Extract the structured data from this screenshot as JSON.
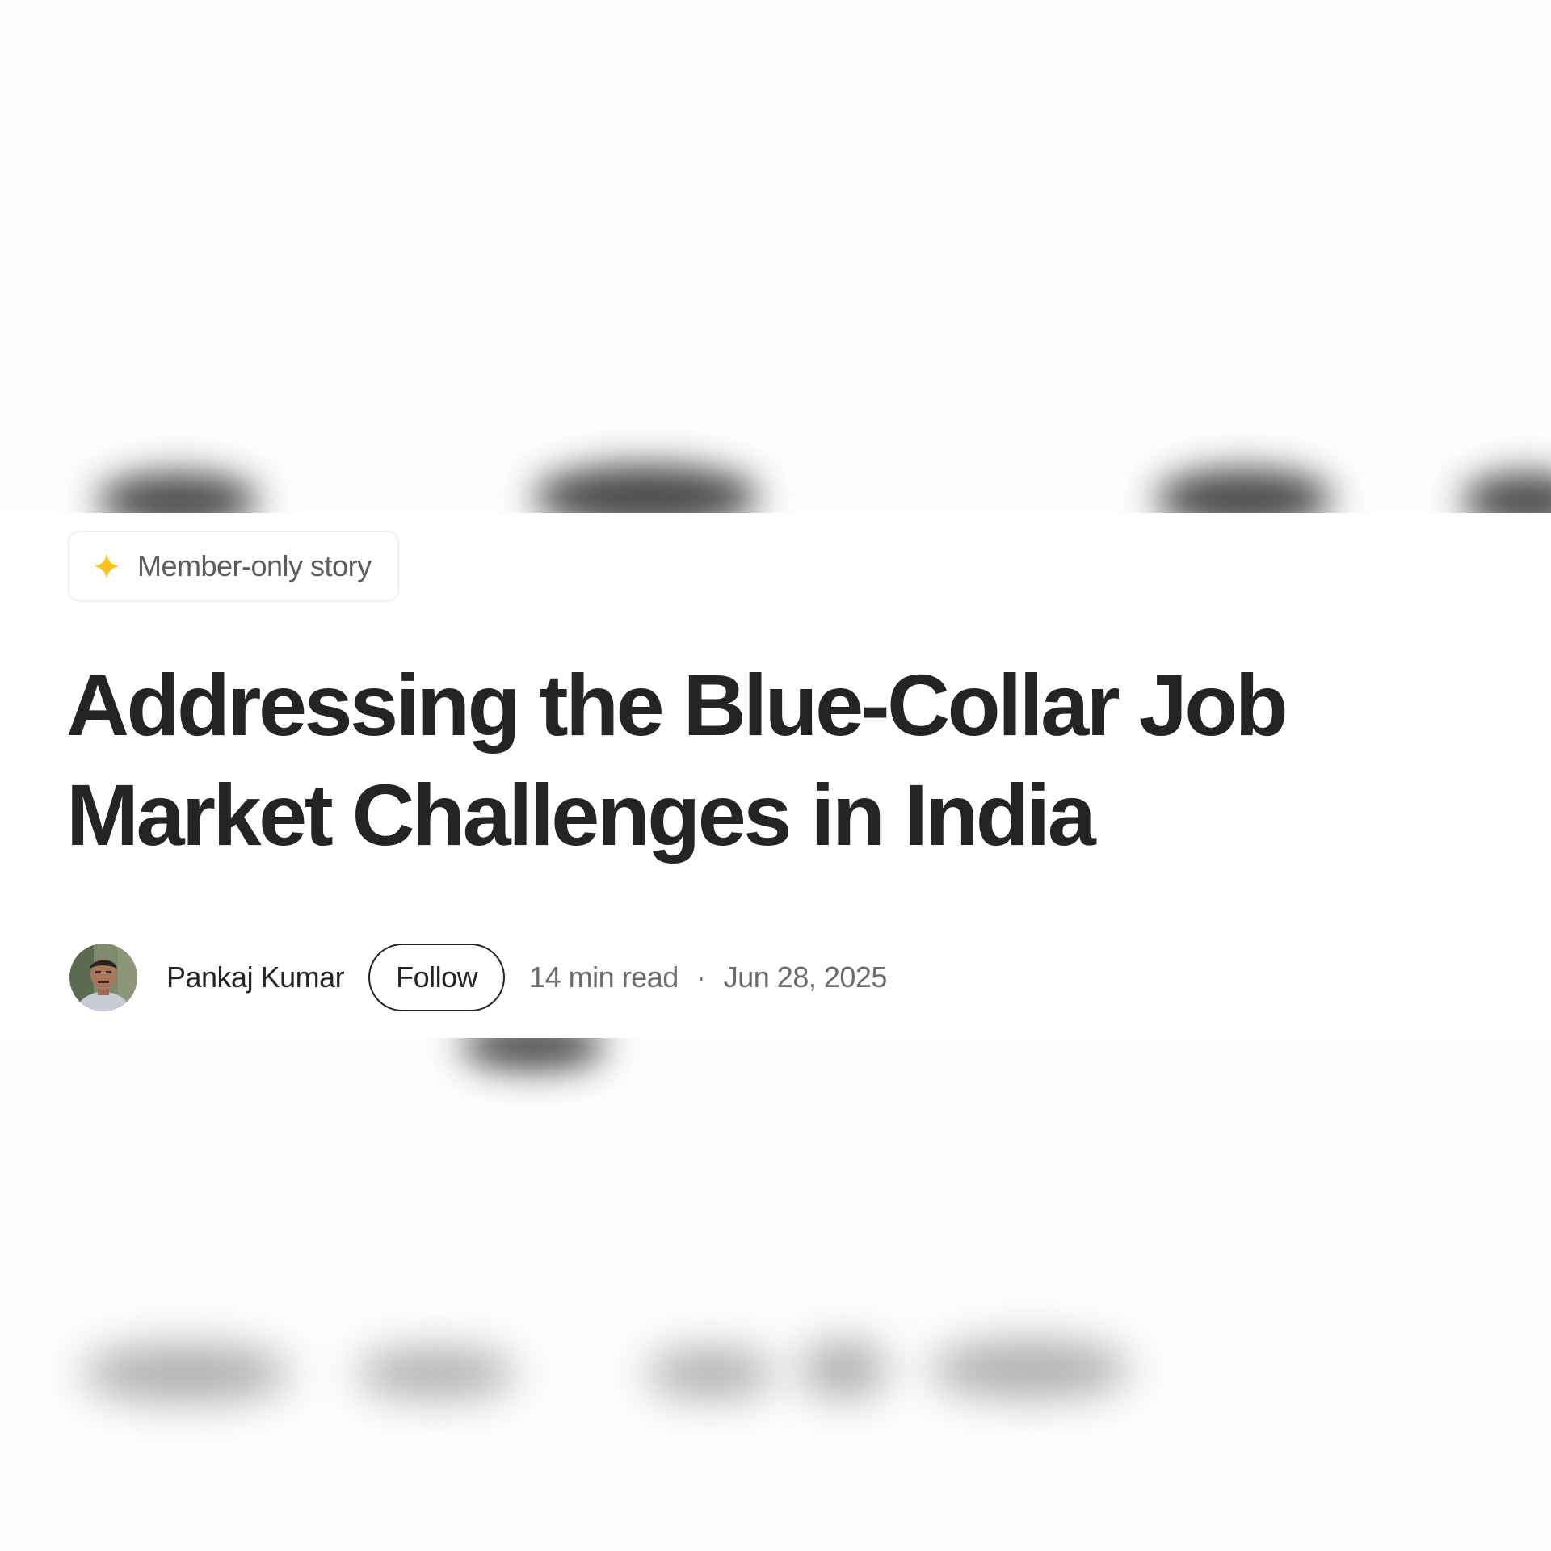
{
  "badge": {
    "label": "Member-only story",
    "icon": "star-icon",
    "icon_color": "#ffc017"
  },
  "article": {
    "title_line1": "Addressing the Blue-Collar Job",
    "title_line2": "Market Challenges in India"
  },
  "byline": {
    "author": "Pankaj Kumar",
    "follow_label": "Follow",
    "read_time": "14 min read",
    "separator": "·",
    "date": "Jun 28, 2025"
  },
  "colors": {
    "text": "#242424",
    "muted": "#6b6b6b",
    "background": "#ffffff"
  }
}
